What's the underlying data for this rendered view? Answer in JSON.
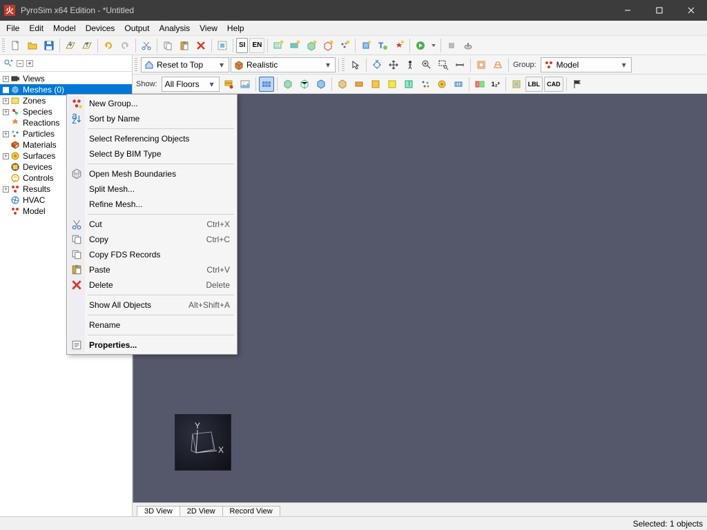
{
  "window": {
    "title": "PyroSim x64 Edition - *Untitled",
    "app_icon_glyph": "火"
  },
  "menubar": [
    "File",
    "Edit",
    "Model",
    "Devices",
    "Output",
    "Analysis",
    "View",
    "Help"
  ],
  "toolbar_main": {
    "btn_si": "SI",
    "btn_en": "EN"
  },
  "toolbar_view_row1": {
    "reset_label": "Reset to Top",
    "render_label": "Realistic",
    "group_label": "Group:",
    "group_value": "Model"
  },
  "toolbar_view_row2": {
    "show_label": "Show:",
    "floors_value": "All Floors",
    "btn_lbl": "LBL",
    "btn_cad": "CAD",
    "btn_123": "1₂³"
  },
  "tree": {
    "nodes": [
      {
        "label": "Views",
        "exp": "+",
        "icon": "camera"
      },
      {
        "label": "Meshes (0)",
        "exp": "",
        "icon": "mesh",
        "selected": true
      },
      {
        "label": "Zones",
        "exp": "+",
        "icon": "zone"
      },
      {
        "label": "Species",
        "exp": "+",
        "icon": "species"
      },
      {
        "label": "Reactions",
        "exp": "",
        "icon": "reaction"
      },
      {
        "label": "Particles",
        "exp": "+",
        "icon": "particle"
      },
      {
        "label": "Materials",
        "exp": "",
        "icon": "material"
      },
      {
        "label": "Surfaces",
        "exp": "+",
        "icon": "surface"
      },
      {
        "label": "Devices",
        "exp": "",
        "icon": "device"
      },
      {
        "label": "Controls",
        "exp": "",
        "icon": "control"
      },
      {
        "label": "Results",
        "exp": "+",
        "icon": "results"
      },
      {
        "label": "HVAC",
        "exp": "",
        "icon": "hvac"
      },
      {
        "label": "Model",
        "exp": "",
        "icon": "model"
      }
    ]
  },
  "context_menu": [
    {
      "type": "item",
      "label": "New Group...",
      "icon": "group"
    },
    {
      "type": "item",
      "label": "Sort by Name",
      "icon": "sort"
    },
    {
      "type": "sep"
    },
    {
      "type": "item",
      "label": "Select Referencing Objects"
    },
    {
      "type": "item",
      "label": "Select By BIM Type"
    },
    {
      "type": "sep"
    },
    {
      "type": "item",
      "label": "Open Mesh Boundaries",
      "icon": "mesh"
    },
    {
      "type": "item",
      "label": "Split Mesh..."
    },
    {
      "type": "item",
      "label": "Refine Mesh..."
    },
    {
      "type": "sep"
    },
    {
      "type": "item",
      "label": "Cut",
      "shortcut": "Ctrl+X",
      "icon": "cut"
    },
    {
      "type": "item",
      "label": "Copy",
      "shortcut": "Ctrl+C",
      "icon": "copy"
    },
    {
      "type": "item",
      "label": "Copy FDS Records",
      "icon": "copy"
    },
    {
      "type": "item",
      "label": "Paste",
      "shortcut": "Ctrl+V",
      "icon": "paste"
    },
    {
      "type": "item",
      "label": "Delete",
      "shortcut": "Delete",
      "icon": "delete"
    },
    {
      "type": "sep"
    },
    {
      "type": "item",
      "label": "Show All Objects",
      "shortcut": "Alt+Shift+A"
    },
    {
      "type": "sep"
    },
    {
      "type": "item",
      "label": "Rename"
    },
    {
      "type": "sep"
    },
    {
      "type": "item",
      "label": "Properties...",
      "bold": true,
      "icon": "props"
    }
  ],
  "view_tabs": [
    "3D View",
    "2D View",
    "Record View"
  ],
  "axis": {
    "x": "X",
    "y": "Y"
  },
  "statusbar": {
    "selection": "Selected: 1 objects"
  }
}
